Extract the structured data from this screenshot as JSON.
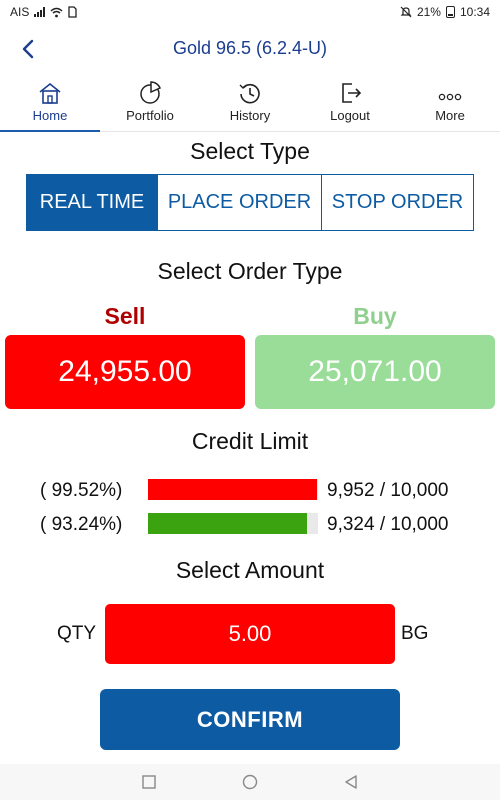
{
  "status_bar": {
    "carrier": "AIS",
    "battery_percent": "21%",
    "time": "10:34",
    "icons": [
      "signal-icon",
      "wifi-icon",
      "sim-icon",
      "mute-icon",
      "battery-icon"
    ]
  },
  "header": {
    "title": "Gold 96.5 (6.2.4-U)",
    "back_icon": "chevron-left-icon"
  },
  "tabs": [
    {
      "label": "Home",
      "icon": "home-icon",
      "active": true
    },
    {
      "label": "Portfolio",
      "icon": "pie-chart-icon",
      "active": false
    },
    {
      "label": "History",
      "icon": "clock-history-icon",
      "active": false
    },
    {
      "label": "Logout",
      "icon": "logout-icon",
      "active": false
    },
    {
      "label": "More",
      "icon": "more-dots-icon",
      "active": false
    }
  ],
  "select_type": {
    "title": "Select Type",
    "options": [
      "REAL TIME",
      "PLACE ORDER",
      "STOP ORDER"
    ],
    "selected": "REAL TIME"
  },
  "order_type": {
    "title": "Select Order Type",
    "sell_label": "Sell",
    "sell_price": "24,955.00",
    "buy_label": "Buy",
    "buy_price": "25,071.00"
  },
  "credit_limit": {
    "title": "Credit Limit",
    "rows": [
      {
        "percent_text": "( 99.52%)",
        "amount_text": "9,952 / 10,000",
        "fraction": 0.9952,
        "color": "#ff0000"
      },
      {
        "percent_text": "( 93.24%)",
        "amount_text": "9,324 / 10,000",
        "fraction": 0.9324,
        "color": "#3aa30f"
      }
    ]
  },
  "amount": {
    "title": "Select Amount",
    "qty_label": "QTY",
    "value": "5.00",
    "unit": "BG"
  },
  "confirm_label": "CONFIRM",
  "colors": {
    "primary": "#0d5ba3",
    "sell": "#ff0000",
    "buy": "#99dd99",
    "sell_text": "#c00000",
    "buy_text": "#8fd08f",
    "title": "#1a3d8f"
  },
  "system_nav": [
    "recent-apps-icon",
    "home-circle-icon",
    "back-triangle-icon"
  ]
}
